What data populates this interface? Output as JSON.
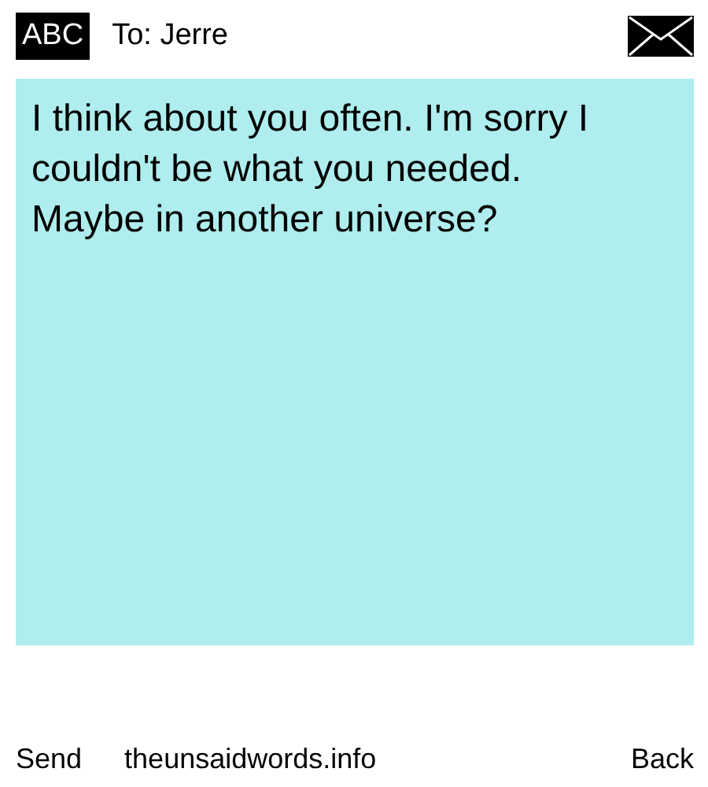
{
  "header": {
    "mode": "ABC",
    "recipient": "To: Jerre"
  },
  "message": {
    "text": "I think about you often. I'm sorry I couldn't be what you needed.\nMaybe in another universe?"
  },
  "footer": {
    "left": "Send",
    "center": "theunsaidwords.info",
    "right": "Back"
  }
}
